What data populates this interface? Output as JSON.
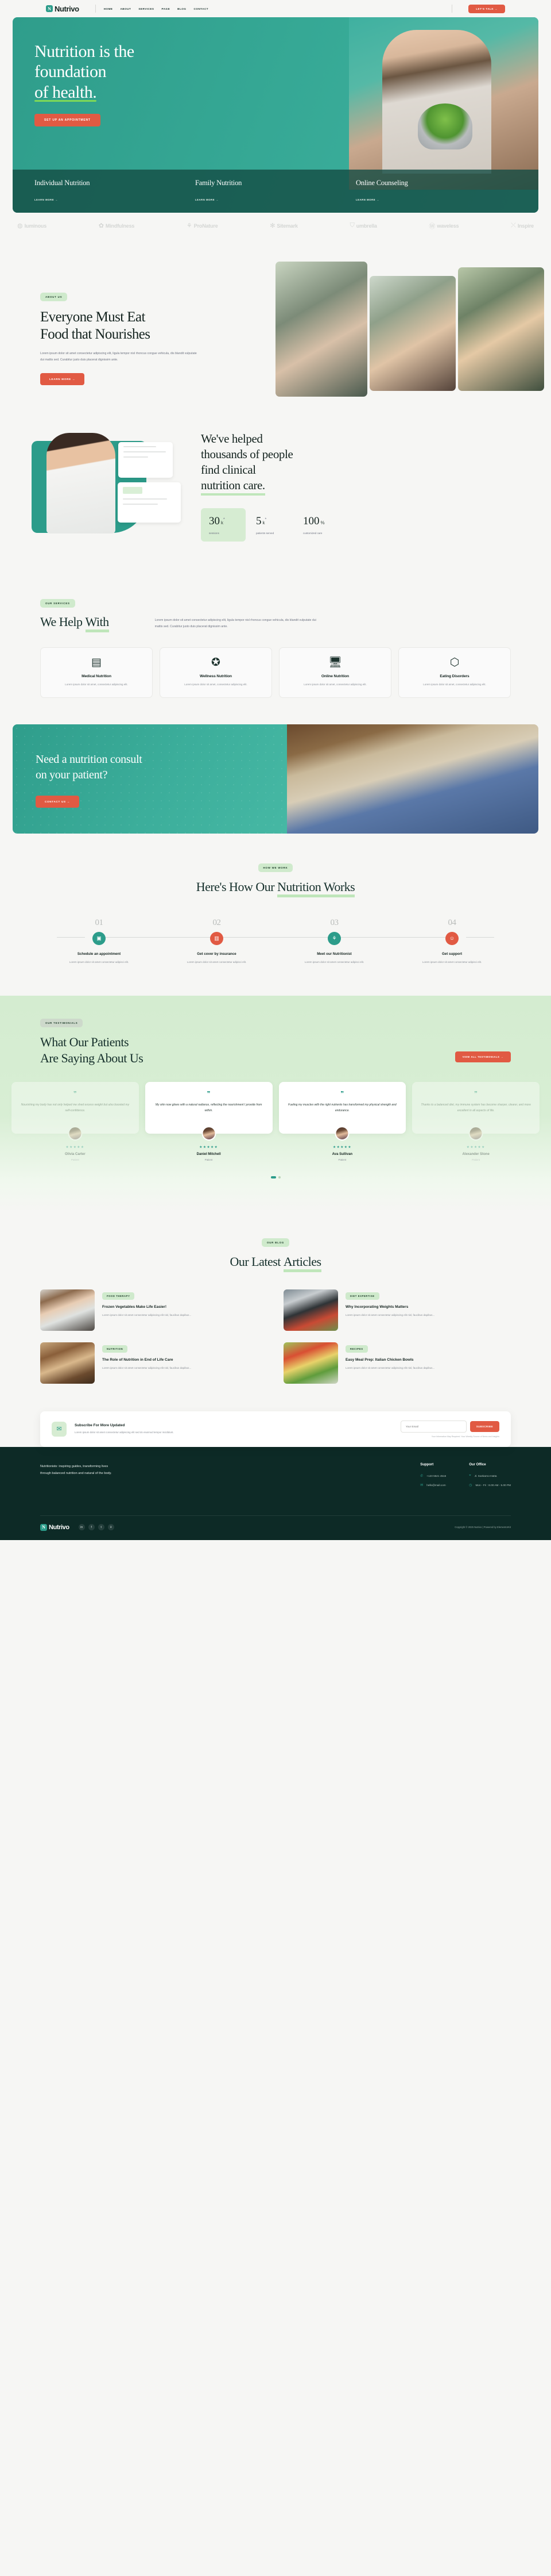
{
  "brand": {
    "name": "Nutrivo",
    "mark": "N",
    "accent": "#2c9c8a",
    "cta_color": "#e15a43"
  },
  "header": {
    "nav": [
      {
        "label": "HOME"
      },
      {
        "label": "ABOUT"
      },
      {
        "label": "SERVICES"
      },
      {
        "label": "PAGE"
      },
      {
        "label": "BLOG"
      },
      {
        "label": "CONTACT"
      }
    ],
    "cta": "LET'S TALK  →"
  },
  "hero": {
    "title_line1": "Nutrition is the",
    "title_line2": "foundation",
    "title_line3": "of health.",
    "cta": "SET UP AN APPOINTMENT",
    "services": [
      {
        "title": "Individual Nutrition",
        "link": "LEARN MORE  →"
      },
      {
        "title": "Family Nutrition",
        "link": "LEARN MORE  →"
      },
      {
        "title": "Online Counseling",
        "link": "LEARN MORE  →"
      }
    ]
  },
  "brands": [
    {
      "glyph": "◍",
      "name": "luminous"
    },
    {
      "glyph": "✿",
      "name": "Mindfulness"
    },
    {
      "glyph": "⚘",
      "name": "ProNature"
    },
    {
      "glyph": "✻",
      "name": "Sitemark"
    },
    {
      "glyph": "⛉",
      "name": "umbrella"
    },
    {
      "glyph": "Ⓦ",
      "name": "waveless"
    },
    {
      "glyph": "⤬",
      "name": "Inspire"
    }
  ],
  "about": {
    "pill": "ABOUT US",
    "title_a": "Everyone Must Eat",
    "title_b": "Food that",
    "title_highlight": "Nourishes",
    "body": "Lorem ipsum dolor sit amet consectetur adipiscing elit, ligula tempor nisl rhoncus congue vehicula, dis blandit vulputate dui mattis sed. Curabitur justo  duis placerat dignissim ante.",
    "cta": "LEARN MORE  →"
  },
  "stats": {
    "title_a": "We've helped",
    "title_b": "thousands of people",
    "title_c": "find clinical",
    "title_highlight": "nutrition care.",
    "items": [
      {
        "num": "30",
        "unit": "k",
        "sup": "*",
        "label": "sessions"
      },
      {
        "num": "5",
        "unit": "k",
        "sup": "*",
        "label": "patients served"
      },
      {
        "num": "100",
        "unit": "%",
        "sup": "",
        "label": "customized care"
      }
    ]
  },
  "services": {
    "pill": "OUR SERVICES",
    "title_a": "We Help",
    "title_highlight": "With",
    "body": "Lorem ipsum dolor sit amet consectetur adipiscing elit, ligula tempor nisl rhoncus congue vehicula, dis blandit vulputate dui mattis sed. Curabitur justo  duis placerat dignissim ante.",
    "cards": [
      {
        "icon": "▤",
        "title": "Medical Nutrition",
        "body": "Lorem ipsum dolor sit amet, consectetur adipiscing elit."
      },
      {
        "icon": "✪",
        "title": "Wellness Nutrition",
        "body": "Lorem ipsum dolor sit amet, consectetur adipiscing elit."
      },
      {
        "icon": "🖥",
        "title": "Online Nutrition",
        "body": "Lorem ipsum dolor sit amet, consectetur adipiscing elit."
      },
      {
        "icon": "⬡",
        "title": "Eating Disorders",
        "body": "Lorem ipsum dolor sit amet, consectetur adipiscing elit."
      }
    ]
  },
  "consult": {
    "title_a": "Need a nutrition consult",
    "title_b": "on your patient?",
    "cta": "CONTACT US  →"
  },
  "how": {
    "pill": "HOW WE WORK",
    "title_a": "Here's How Our",
    "title_highlight": "Nutrition Works",
    "steps": [
      {
        "num": "01",
        "icon": "▣",
        "title": "Schedule an appointment",
        "body": "Lorem ipsum dolor sit amet consectetur adipisci elit."
      },
      {
        "num": "02",
        "icon": "▥",
        "title": "Get cover by insurance",
        "body": "Lorem ipsum dolor sit amet consectetur adipisci elit."
      },
      {
        "num": "03",
        "icon": "⚘",
        "title": "Meet our Nutritionist",
        "body": "Lorem ipsum dolor sit amet consectetur adipisci elit."
      },
      {
        "num": "04",
        "icon": "☺",
        "title": "Get support",
        "body": "Lorem ipsum dolor sit amet consectetur adipisci elit."
      }
    ]
  },
  "testimonials": {
    "pill": "OUR TESTIMONIALS",
    "title_a": "What Our Patients",
    "title_b": "Are Saying",
    "title_highlight": "About Us",
    "cta": "VIEW ALL TESTIMONIALS  →",
    "quote_glyph": "❞",
    "stars": "★★★★★",
    "cards": [
      {
        "quote": "Nourishing my body has not only helped me shed excess weight but also boosted my self-confidence.",
        "name": "Olivia Carter",
        "role": "Patient"
      },
      {
        "quote": "My skin now glows with a natural radiance, reflecting the nourishment I provide from within.",
        "name": "Daniel Mitchell",
        "role": "Patient"
      },
      {
        "quote": "Fueling my muscles with the right nutrients has transformed my physical strength and endurance.",
        "name": "Ava Sullivan",
        "role": "Patient"
      },
      {
        "quote": "Thanks to a balanced diet, my immune system has become sharper, clearer, and more excellent in all aspects of life.",
        "name": "Alexander Stone",
        "role": "Patient"
      }
    ]
  },
  "blog": {
    "pill": "OUR BLOG",
    "title_a": "Our Latest",
    "title_highlight": "Articles",
    "posts": [
      {
        "tag": "FOOD THERAPY",
        "title": "Frozen Vegetables Make Life Easier!",
        "body": "Lorem ipsum dolor sit amet consectetur adipiscing elit nisl, faucibus dapibus..."
      },
      {
        "tag": "DIET EXPERTISE",
        "title": "Why Incorporating Weights Matters",
        "body": "Lorem ipsum dolor sit amet consectetur adipiscing elit nisl, faucibus dapibus..."
      },
      {
        "tag": "NUTRITION",
        "title": "The Role of Nutrition in End of Life Care",
        "body": "Lorem ipsum dolor sit amet consectetur adipiscing elit nisl, faucibus dapibus..."
      },
      {
        "tag": "RECIPES",
        "title": "Easy Meal Prep: Italian Chicken Bowls",
        "body": "Lorem ipsum dolor sit amet consectetur adipiscing elit nisl, faucibus dapibus..."
      }
    ]
  },
  "newsletter": {
    "icon": "✉",
    "title": "Subscribe For More Updated",
    "body": "Lorem ipsum dolor sit amet consectetur adipiscing elit sed do eiusmod tempor incididunt.",
    "placeholder": "Your Email",
    "cta": "SUBSCRIBE",
    "note": "Your Information May Required. Your Weekly Source of News and Insights"
  },
  "footer": {
    "tagline_a": "Nutritionists: inspiring guides, transforming lives",
    "tagline_b": "through balanced nutrition and natural of the body.",
    "support": {
      "heading": "Support",
      "items": [
        {
          "icon": "✆",
          "text": "+123 5521 4516"
        },
        {
          "icon": "✉",
          "text": "hello@mail.com"
        }
      ]
    },
    "office": {
      "heading": "Our Office",
      "items": [
        {
          "icon": "⌖",
          "text": "Jl. Soekarno-Hatta"
        },
        {
          "icon": "◷",
          "text": "Mon - Fri : 8.00 AM - 5.00 PM"
        }
      ]
    },
    "social": [
      "in",
      "f",
      "t",
      "⌾"
    ],
    "copyright": "Copyright © 2025 Nutrivo | Powered by ElementorKit"
  }
}
